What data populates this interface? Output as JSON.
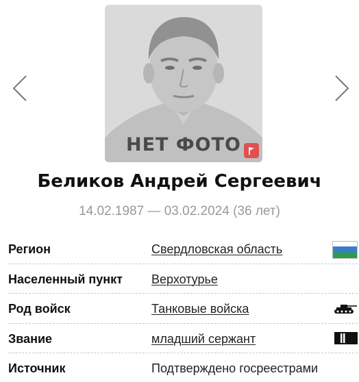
{
  "nav": {
    "prev_icon": "chevron-left-icon",
    "next_icon": "chevron-right-icon"
  },
  "photo": {
    "placeholder_text": "НЕТ ФОТО",
    "flag_icon": "flag-icon",
    "flag_color": "#e05050"
  },
  "person": {
    "name": "Беликов Андрей Сергеевич",
    "dates": "14.02.1987 — 03.02.2024 (36 лет)"
  },
  "details": [
    {
      "label": "Регион",
      "value": "Свердловская область",
      "link": true,
      "icon": "region-flag-icon"
    },
    {
      "label": "Населенный пункт",
      "value": "Верхотурье",
      "link": true,
      "icon": ""
    },
    {
      "label": "Род войск",
      "value": "Танковые войска",
      "link": true,
      "icon": "tank-icon"
    },
    {
      "label": "Звание",
      "value": "младший сержант",
      "link": true,
      "icon": "rank-insignia-icon"
    },
    {
      "label": "Источник",
      "value": "Подтверждено госреестрами",
      "link": false,
      "icon": ""
    }
  ],
  "colors": {
    "dates_text": "#999999",
    "region_flag_top": "#ffffff",
    "region_flag_mid": "#3a7ec8",
    "region_flag_bottom": "#2e9a4a"
  }
}
